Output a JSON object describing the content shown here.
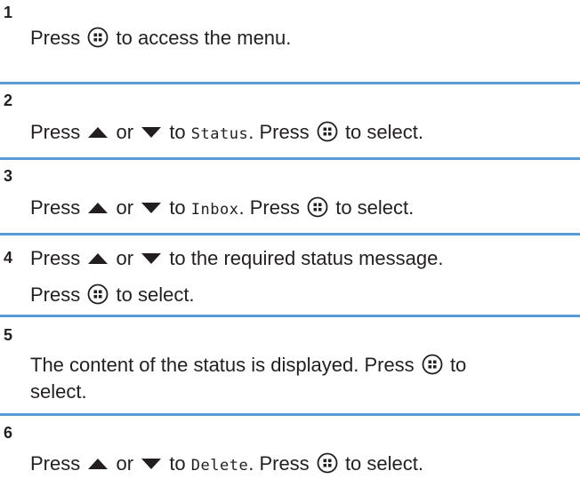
{
  "colors": {
    "rule": "#5b9bd5",
    "text": "#231f20"
  },
  "icons": {
    "menu_ok_button": "menu-ok-button-icon",
    "up": "up-arrow-icon",
    "down": "down-arrow-icon"
  },
  "steps": [
    {
      "number": "1",
      "t1": "Press",
      "t2": "to access the menu."
    },
    {
      "number": "2",
      "t1": "Press",
      "or": "or",
      "to": "to",
      "target": "Status",
      "t2": ". Press",
      "t3": "to select."
    },
    {
      "number": "3",
      "t1": "Press",
      "or": "or",
      "to": "to",
      "target": "Inbox",
      "t2": ". Press",
      "t3": "to select."
    },
    {
      "number": "4",
      "t1": "Press",
      "or": "or",
      "t2": "to the required status message.",
      "t3": "Press",
      "t4": "to select."
    },
    {
      "number": "5",
      "t1": "The content of the status is displayed. Press",
      "t2": "to",
      "t3": "select."
    },
    {
      "number": "6",
      "t1": "Press",
      "or": "or",
      "to": "to",
      "target": "Delete",
      "t2": ". Press",
      "t3": "to select."
    }
  ]
}
